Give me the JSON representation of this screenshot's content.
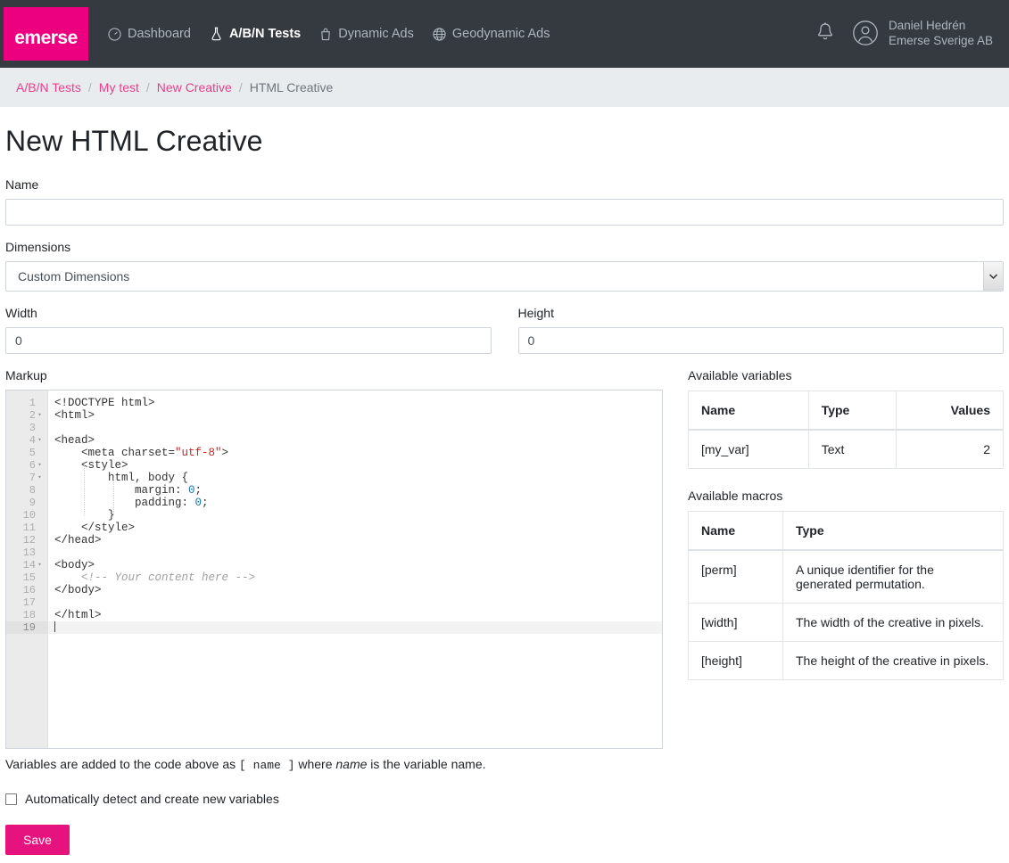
{
  "brand": {
    "name": "emerse",
    "color": "#ec0080"
  },
  "nav": {
    "items": [
      {
        "label": "Dashboard",
        "icon": "speedometer-icon",
        "active": false
      },
      {
        "label": "A/B/N Tests",
        "icon": "flask-icon",
        "active": true
      },
      {
        "label": "Dynamic Ads",
        "icon": "shopping-bag-icon",
        "active": false
      },
      {
        "label": "Geodynamic Ads",
        "icon": "globe-icon",
        "active": false
      }
    ]
  },
  "user": {
    "name": "Daniel Hedrén",
    "company": "Emerse Sverige AB",
    "notifications_icon": "bell-icon",
    "avatar_icon": "user-circle-icon"
  },
  "breadcrumb": {
    "items": [
      {
        "label": "A/B/N Tests",
        "current": false
      },
      {
        "label": "My test",
        "current": false
      },
      {
        "label": "New Creative",
        "current": false
      },
      {
        "label": "HTML Creative",
        "current": true
      }
    ],
    "separator": "/"
  },
  "page": {
    "title": "New HTML Creative"
  },
  "form": {
    "name": {
      "label": "Name",
      "value": "",
      "placeholder": ""
    },
    "dimensions": {
      "label": "Dimensions",
      "selected": "Custom Dimensions",
      "options": [
        "Custom Dimensions"
      ]
    },
    "width": {
      "label": "Width",
      "value": "0"
    },
    "height": {
      "label": "Height",
      "value": "0"
    },
    "markup": {
      "label": "Markup"
    },
    "helper_text_pre": "Variables are added to the code above as ",
    "helper_text_token": "[ name ]",
    "helper_text_mid": " where ",
    "helper_text_em": "name",
    "helper_text_post": " is the variable name.",
    "auto_detect": {
      "label": "Automatically detect and create new variables",
      "checked": false
    },
    "save_label": "Save"
  },
  "editor": {
    "lines": [
      {
        "n": "1",
        "fold": false,
        "html": "&lt;!DOCTYPE html&gt;"
      },
      {
        "n": "2",
        "fold": true,
        "html": "&lt;html&gt;"
      },
      {
        "n": "3",
        "fold": false,
        "html": ""
      },
      {
        "n": "4",
        "fold": true,
        "html": "&lt;head&gt;"
      },
      {
        "n": "5",
        "fold": false,
        "html": "    &lt;meta charset=<span class=\"tok-str\">\"utf-8\"</span>&gt;"
      },
      {
        "n": "6",
        "fold": true,
        "html": "    &lt;style&gt;"
      },
      {
        "n": "7",
        "fold": true,
        "html": "        html, body {"
      },
      {
        "n": "8",
        "fold": false,
        "html": "            margin: <span class=\"tok-num\">0</span>;"
      },
      {
        "n": "9",
        "fold": false,
        "html": "            padding: <span class=\"tok-num\">0</span>;"
      },
      {
        "n": "10",
        "fold": false,
        "html": "        }"
      },
      {
        "n": "11",
        "fold": false,
        "html": "    &lt;/style&gt;"
      },
      {
        "n": "12",
        "fold": false,
        "html": "&lt;/head&gt;"
      },
      {
        "n": "13",
        "fold": false,
        "html": ""
      },
      {
        "n": "14",
        "fold": true,
        "html": "&lt;body&gt;"
      },
      {
        "n": "15",
        "fold": false,
        "html": "    <span class=\"tok-com\">&lt;!-- Your content here --&gt;</span>"
      },
      {
        "n": "16",
        "fold": false,
        "html": "&lt;/body&gt;"
      },
      {
        "n": "17",
        "fold": false,
        "html": ""
      },
      {
        "n": "18",
        "fold": false,
        "html": "&lt;/html&gt;"
      },
      {
        "n": "19",
        "fold": false,
        "active": true,
        "html": "<span class=\"cursor\"></span>"
      }
    ],
    "total_gutter_rows": 28
  },
  "variables": {
    "title": "Available variables",
    "columns": [
      "Name",
      "Type",
      "Values"
    ],
    "rows": [
      {
        "name": "[my_var]",
        "type": "Text",
        "values": "2"
      }
    ]
  },
  "macros": {
    "title": "Available macros",
    "columns": [
      "Name",
      "Type"
    ],
    "rows": [
      {
        "name": "[perm]",
        "type": "A unique identifier for the generated permutation."
      },
      {
        "name": "[width]",
        "type": "The width of the creative in pixels."
      },
      {
        "name": "[height]",
        "type": "The height of the creative in pixels."
      }
    ]
  }
}
